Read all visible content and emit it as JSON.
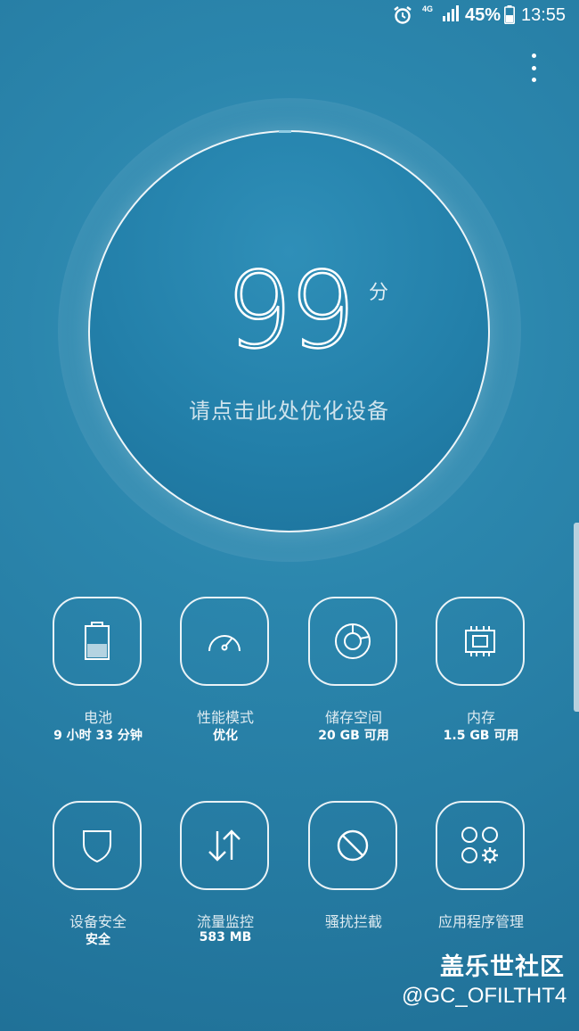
{
  "status_bar": {
    "network": "4G",
    "battery_percent": "45%",
    "time": "13:55",
    "icons": [
      "alarm-icon",
      "signal-icon",
      "battery-icon"
    ]
  },
  "header": {
    "menu_icon": "more-vertical-icon"
  },
  "score": {
    "value": "99",
    "unit": "分",
    "hint": "请点击此处优化设备"
  },
  "tiles": [
    {
      "label": "电池",
      "value": "9 小时 33 分钟",
      "icon": "battery-icon",
      "battery_level": 0.45
    },
    {
      "label": "性能模式",
      "value": "优化",
      "icon": "speedometer-icon"
    },
    {
      "label": "储存空间",
      "value": "20 GB 可用",
      "icon": "storage-donut-icon"
    },
    {
      "label": "内存",
      "value": "1.5 GB 可用",
      "icon": "memory-chip-icon"
    },
    {
      "label": "设备安全",
      "value": "安全",
      "icon": "shield-icon"
    },
    {
      "label": "流量监控",
      "value": "583 MB",
      "icon": "up-down-arrows-icon"
    },
    {
      "label": "骚扰拦截",
      "value": "",
      "icon": "block-icon"
    },
    {
      "label": "应用程序管理",
      "value": "",
      "icon": "apps-gear-icon"
    }
  ],
  "watermark": {
    "title": "盖乐世社区",
    "handle": "@GC_OFILTHT4"
  },
  "colors": {
    "background": "#2680aa",
    "ring": "#ffffff"
  }
}
